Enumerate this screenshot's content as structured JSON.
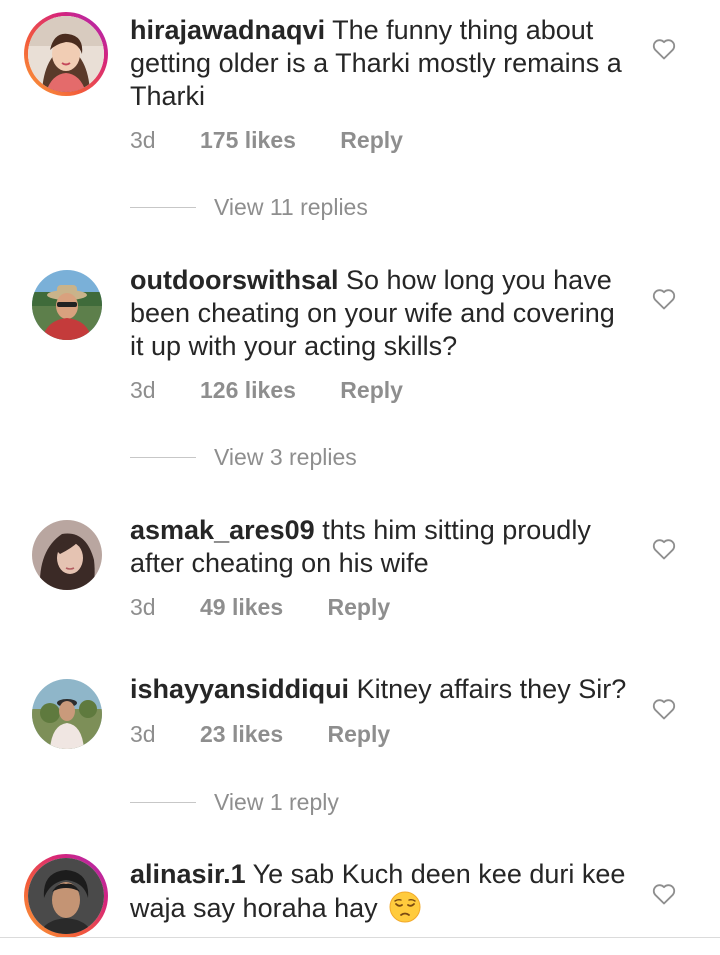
{
  "comments": [
    {
      "username": "hirajawadnaqvi",
      "text": "The funny thing about getting older is a Tharki mostly remains a Tharki",
      "time": "3d",
      "likes": "175 likes",
      "reply": "Reply",
      "view_replies": "View 11 replies",
      "avatar_ring": true
    },
    {
      "username": "outdoorswithsal",
      "text": "So how long you have been cheating on your wife and covering it up with your acting skills?",
      "time": "3d",
      "likes": "126 likes",
      "reply": "Reply",
      "view_replies": "View 3 replies",
      "avatar_ring": false
    },
    {
      "username": "asmak_ares09",
      "text": "thts him sitting proudly after cheating on his wife",
      "time": "3d",
      "likes": "49 likes",
      "reply": "Reply",
      "avatar_ring": false
    },
    {
      "username": "ishayyansiddiqui",
      "text": "Kitney affairs they Sir?",
      "time": "3d",
      "likes": "23 likes",
      "reply": "Reply",
      "view_replies": "View 1 reply",
      "avatar_ring": false
    },
    {
      "username": "alinasir.1",
      "text": "Ye sab Kuch deen kee duri kee waja say horaha hay",
      "emoji": "pensive-face",
      "avatar_ring": true
    }
  ],
  "icons": {
    "like": "heart-outline-icon"
  },
  "colors": {
    "text": "#262626",
    "secondary": "#8e8e8e",
    "story_ring_start": "#f9a23a",
    "story_ring_end": "#a22bc2"
  }
}
